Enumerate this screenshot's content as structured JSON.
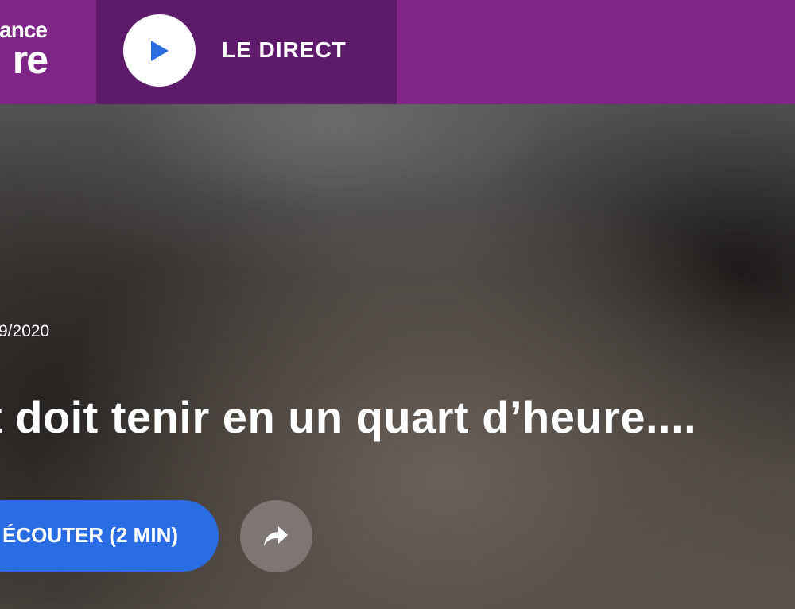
{
  "header": {
    "logo": {
      "line1": "ance",
      "line2": "re"
    },
    "live": {
      "play_icon": "play-icon",
      "label": "LE DIRECT"
    }
  },
  "hero": {
    "date": "9/2020",
    "title": "t doit tenir en un quart d’heure....",
    "listen_button": {
      "label": "ÉCOUTER (2 MIN)"
    },
    "share_button": {
      "icon": "share-arrow-icon"
    }
  },
  "colors": {
    "brand_purple": "#7e2587",
    "live_purple": "#5e1a6b",
    "play_blue": "#2a6de3",
    "listen_blue": "#2a6de3",
    "share_gray": "#7d7672"
  }
}
